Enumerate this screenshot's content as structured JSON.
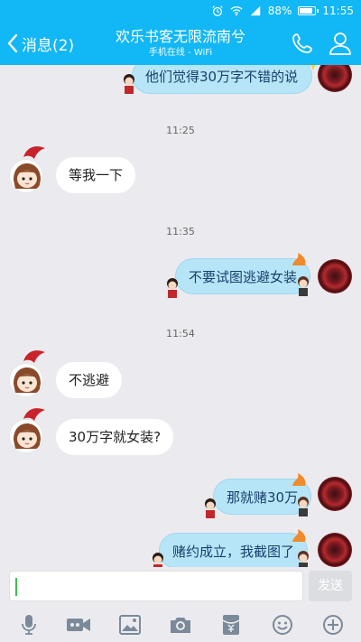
{
  "status_bar": {
    "battery_percent": "88%",
    "battery_level": 0.88,
    "time": "11:55"
  },
  "header": {
    "back_label": "消息(2)",
    "title": "欢乐书客无限流南兮",
    "subtitle": "手机在线 - WiFi"
  },
  "messages": [
    {
      "type": "outgoing",
      "text": "他们觉得30万字不错的说"
    },
    {
      "type": "timestamp",
      "text": "11:25"
    },
    {
      "type": "incoming",
      "text": "等我一下"
    },
    {
      "type": "timestamp",
      "text": "11:35"
    },
    {
      "type": "outgoing",
      "text": "不要试图逃避女装"
    },
    {
      "type": "timestamp",
      "text": "11:54"
    },
    {
      "type": "incoming",
      "text": "不逃避"
    },
    {
      "type": "incoming",
      "text": "30万字就女装?"
    },
    {
      "type": "outgoing",
      "text": "那就赌30万"
    },
    {
      "type": "outgoing",
      "text": "赌约成立，我截图了"
    }
  ],
  "composer": {
    "send_label": "发送"
  },
  "toolbar": [
    "mic-icon",
    "video-icon",
    "image-icon",
    "camera-icon",
    "red-packet-icon",
    "emoji-icon",
    "plus-icon"
  ],
  "colors": {
    "brand": "#12b7f5",
    "outgoing_bubble": "#b7e5f8",
    "incoming_bubble": "#ffffff",
    "background": "#ebebef"
  }
}
